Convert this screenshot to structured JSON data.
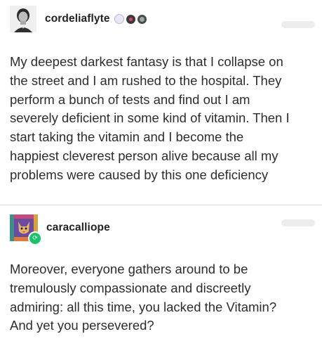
{
  "posts": [
    {
      "username": "cordeliaflyte",
      "avatar": "portrait-photo",
      "badges": [
        "ghost-badge-icon",
        "heart-creature-badge-icon",
        "skull-badge-icon"
      ],
      "text": "My deepest darkest fantasy is that I collapse on\nthe street and I am rushed to the hospital. They\nperform a bunch of tests and find out I am\nseverely deficient in some kind of vitamin. Then I\nstart taking the vitamin and I become the\nhappiest cleverest person alive because all my\nproblems were caused by this one deficiency"
    },
    {
      "username": "caracalliope",
      "avatar": "illustrated-cat",
      "reblog_icon": "reblog-icon",
      "text": "Moreover, everyone gathers around to be\ntremulously compassionate and discreetly\nadmiring: all this time, you lacked the Vitamin?\nAnd yet you persevered?"
    }
  ],
  "colors": {
    "text": "#2d2d2d",
    "reblog_green": "#19c26b",
    "divider": "#dcdcdc"
  }
}
